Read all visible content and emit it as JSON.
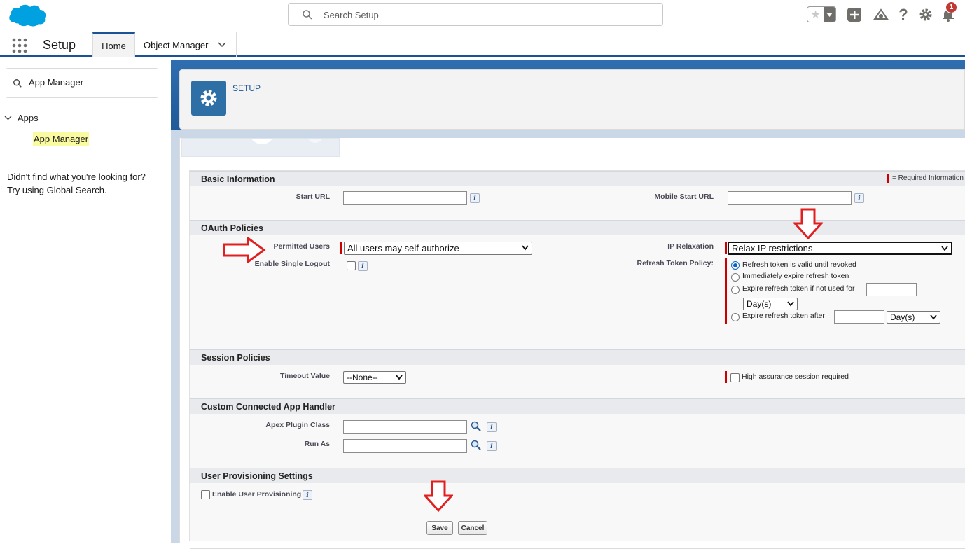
{
  "header": {
    "search_placeholder": "Search Setup",
    "notification_count": "1",
    "brand_color": "#00a1e0"
  },
  "context_nav": {
    "app_name": "Setup",
    "tabs": [
      {
        "label": "Home",
        "active": true
      },
      {
        "label": "Object Manager",
        "active": false
      }
    ]
  },
  "sidebar": {
    "quick_find_value": "App Manager",
    "tree": {
      "group_label": "Apps",
      "item_label": "App Manager"
    },
    "help_line1": "Didn't find what you're looking for?",
    "help_line2": "Try using Global Search."
  },
  "page_header": {
    "eyebrow": "SETUP"
  },
  "form": {
    "required_legend": "= Required Information",
    "sections": {
      "basic": {
        "title": "Basic Information",
        "start_url_label": "Start URL",
        "start_url_value": "",
        "mobile_start_url_label": "Mobile Start URL",
        "mobile_start_url_value": ""
      },
      "oauth": {
        "title": "OAuth Policies",
        "permitted_users_label": "Permitted Users",
        "permitted_users_value": "All users may self-authorize",
        "enable_single_logout_label": "Enable Single Logout",
        "enable_single_logout_checked": false,
        "ip_relaxation_label": "IP Relaxation",
        "ip_relaxation_value": "Relax IP restrictions",
        "refresh_token_policy_label": "Refresh Token Policy:",
        "refresh_options": [
          {
            "label": "Refresh token is valid until revoked",
            "selected": true
          },
          {
            "label": "Immediately expire refresh token",
            "selected": false
          },
          {
            "label": "Expire refresh token if not used for",
            "selected": false
          },
          {
            "label": "Expire refresh token after",
            "selected": false
          }
        ],
        "unit_not_used": "Day(s)",
        "unit_after": "Day(s)"
      },
      "session": {
        "title": "Session Policies",
        "timeout_label": "Timeout Value",
        "timeout_value": "--None--",
        "high_assurance_label": "High assurance session required",
        "high_assurance_checked": false
      },
      "handler": {
        "title": "Custom Connected App Handler",
        "apex_plugin_label": "Apex Plugin Class",
        "apex_plugin_value": "",
        "run_as_label": "Run As",
        "run_as_value": ""
      },
      "provisioning": {
        "title": "User Provisioning Settings",
        "enable_label": "Enable User Provisioning",
        "enable_checked": false
      }
    },
    "buttons": {
      "save": "Save",
      "cancel": "Cancel"
    }
  },
  "annotation_color": "#e02020"
}
